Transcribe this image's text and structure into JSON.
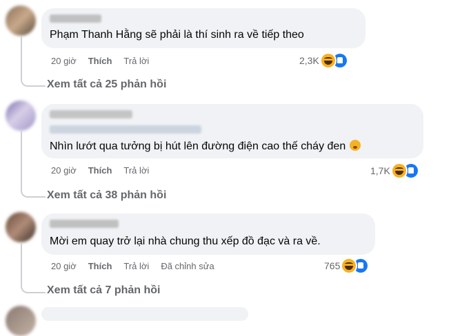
{
  "comments": [
    {
      "text": "Phạm Thanh Hằng sẽ phải là thí sinh ra về tiếp theo",
      "time": "20 giờ",
      "like": "Thích",
      "reply": "Trả lời",
      "edited": "",
      "reaction_count": "2,3K",
      "view_replies": "Xem tất cả 25 phản hồi"
    },
    {
      "text": "Nhìn lướt qua tưởng bị hút lên đường điện cao thế cháy đen",
      "time": "20 giờ",
      "like": "Thích",
      "reply": "Trả lời",
      "edited": "",
      "reaction_count": "1,7K",
      "view_replies": "Xem tất cả 38 phản hồi"
    },
    {
      "text": "Mời em quay trở lại nhà chung thu xếp đồ đạc và ra về.",
      "time": "20 giờ",
      "like": "Thích",
      "reply": "Trả lời",
      "edited": "Đã chỉnh sửa",
      "reaction_count": "765",
      "view_replies": "Xem tất cả 7 phản hồi"
    }
  ],
  "icons": [
    "haha-icon",
    "like-icon",
    "flushed-face-icon"
  ],
  "colors": {
    "bubble": "#f0f2f5",
    "secondary_text": "#65676b",
    "like_blue": "#1877f2",
    "haha_yellow": "#f7b125"
  }
}
